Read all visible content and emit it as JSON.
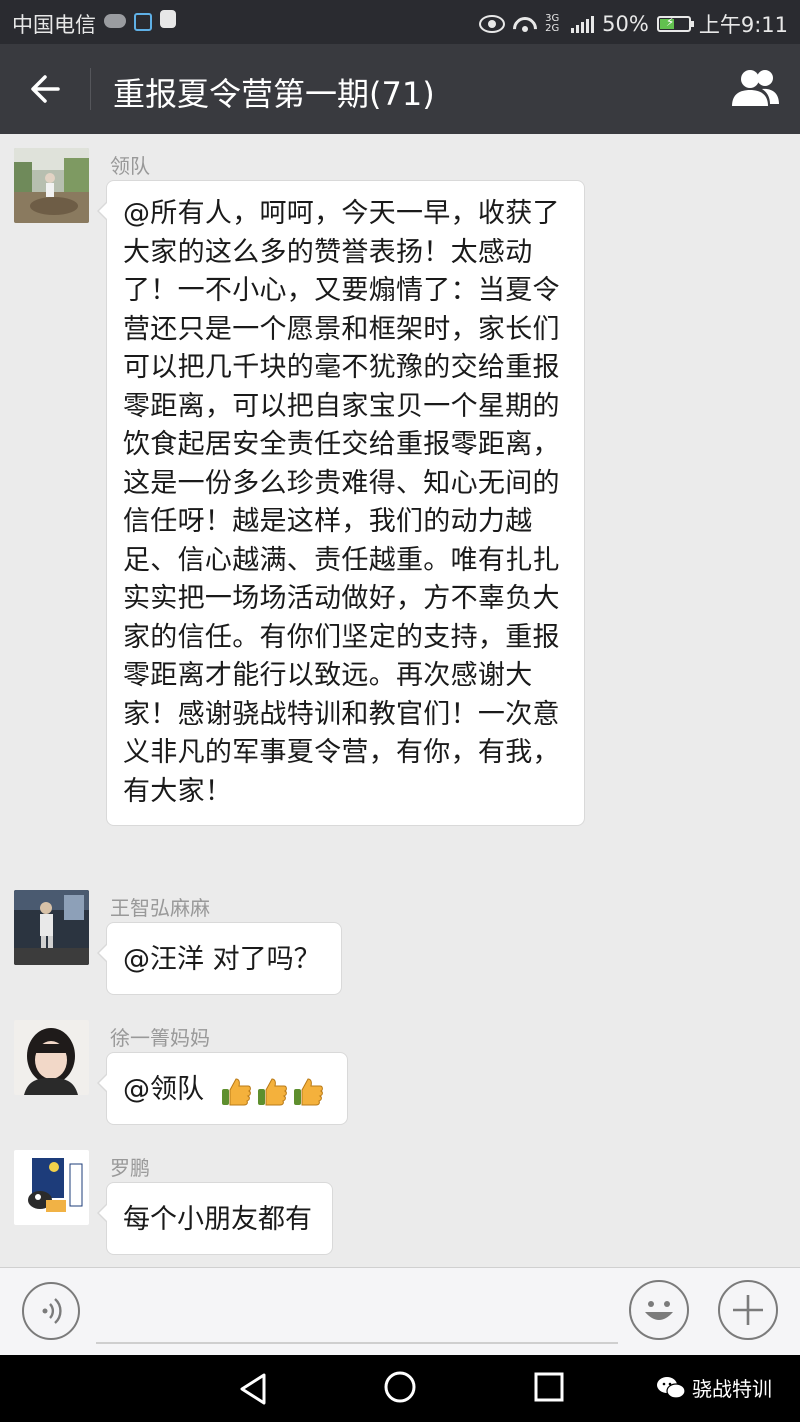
{
  "status_bar": {
    "carrier": "中国电信",
    "network_type": "3G 2G",
    "battery": "50%",
    "battery_level": 0.5,
    "time": "上午9:11",
    "colors": {
      "background": "#2a2b30",
      "battery_fill": "#62c14f"
    }
  },
  "header": {
    "back_icon": "arrow-left-icon",
    "title": "重报夏令营第一期(71)",
    "members_icon": "group-members-icon",
    "background": "#393a3f"
  },
  "messages": [
    {
      "sender": "领队",
      "avatar": "avatar-photo-outdoor",
      "text": "@所有人，呵呵，今天一早，收获了大家的这么多的赞誉表扬！太感动了！一不小心，又要煽情了：当夏令营还只是一个愿景和框架时，家长们可以把几千块的毫不犹豫的交给重报零距离，可以把自家宝贝一个星期的饮食起居安全责任交给重报零距离，这是一份多么珍贵难得、知心无间的信任呀！越是这样，我们的动力越足、信心越满、责任越重。唯有扎扎实实把一场场活动做好，方不辜负大家的信任。有你们坚定的支持，重报零距离才能行以致远。再次感谢大家！感谢骁战特训和教官们！一次意义非凡的军事夏令营，有你，有我，有大家！"
    },
    {
      "sender": "王智弘麻麻",
      "avatar": "avatar-photo-night",
      "text": "@汪洋 对了吗？"
    },
    {
      "sender": "徐一箐妈妈",
      "avatar": "avatar-photo-portrait",
      "text": "@领队",
      "emoji": [
        "thumbs-up-emoji",
        "thumbs-up-emoji",
        "thumbs-up-emoji"
      ]
    },
    {
      "sender": "罗鹏",
      "avatar": "avatar-cartoon",
      "text": "每个小朋友都有"
    }
  ],
  "input_bar": {
    "voice_icon": "voice-icon",
    "input_value": "",
    "emoji_icon": "smiley-icon",
    "more_icon": "plus-icon"
  },
  "nav_bar": {
    "back_icon": "triangle-back-icon",
    "home_icon": "circle-home-icon",
    "recent_icon": "square-recent-icon",
    "watermark_icon": "wechat-icon",
    "watermark_text": "骁战特训"
  },
  "colors": {
    "chat_background": "#ebebeb",
    "bubble": "#ffffff",
    "sender_name": "#999999"
  }
}
